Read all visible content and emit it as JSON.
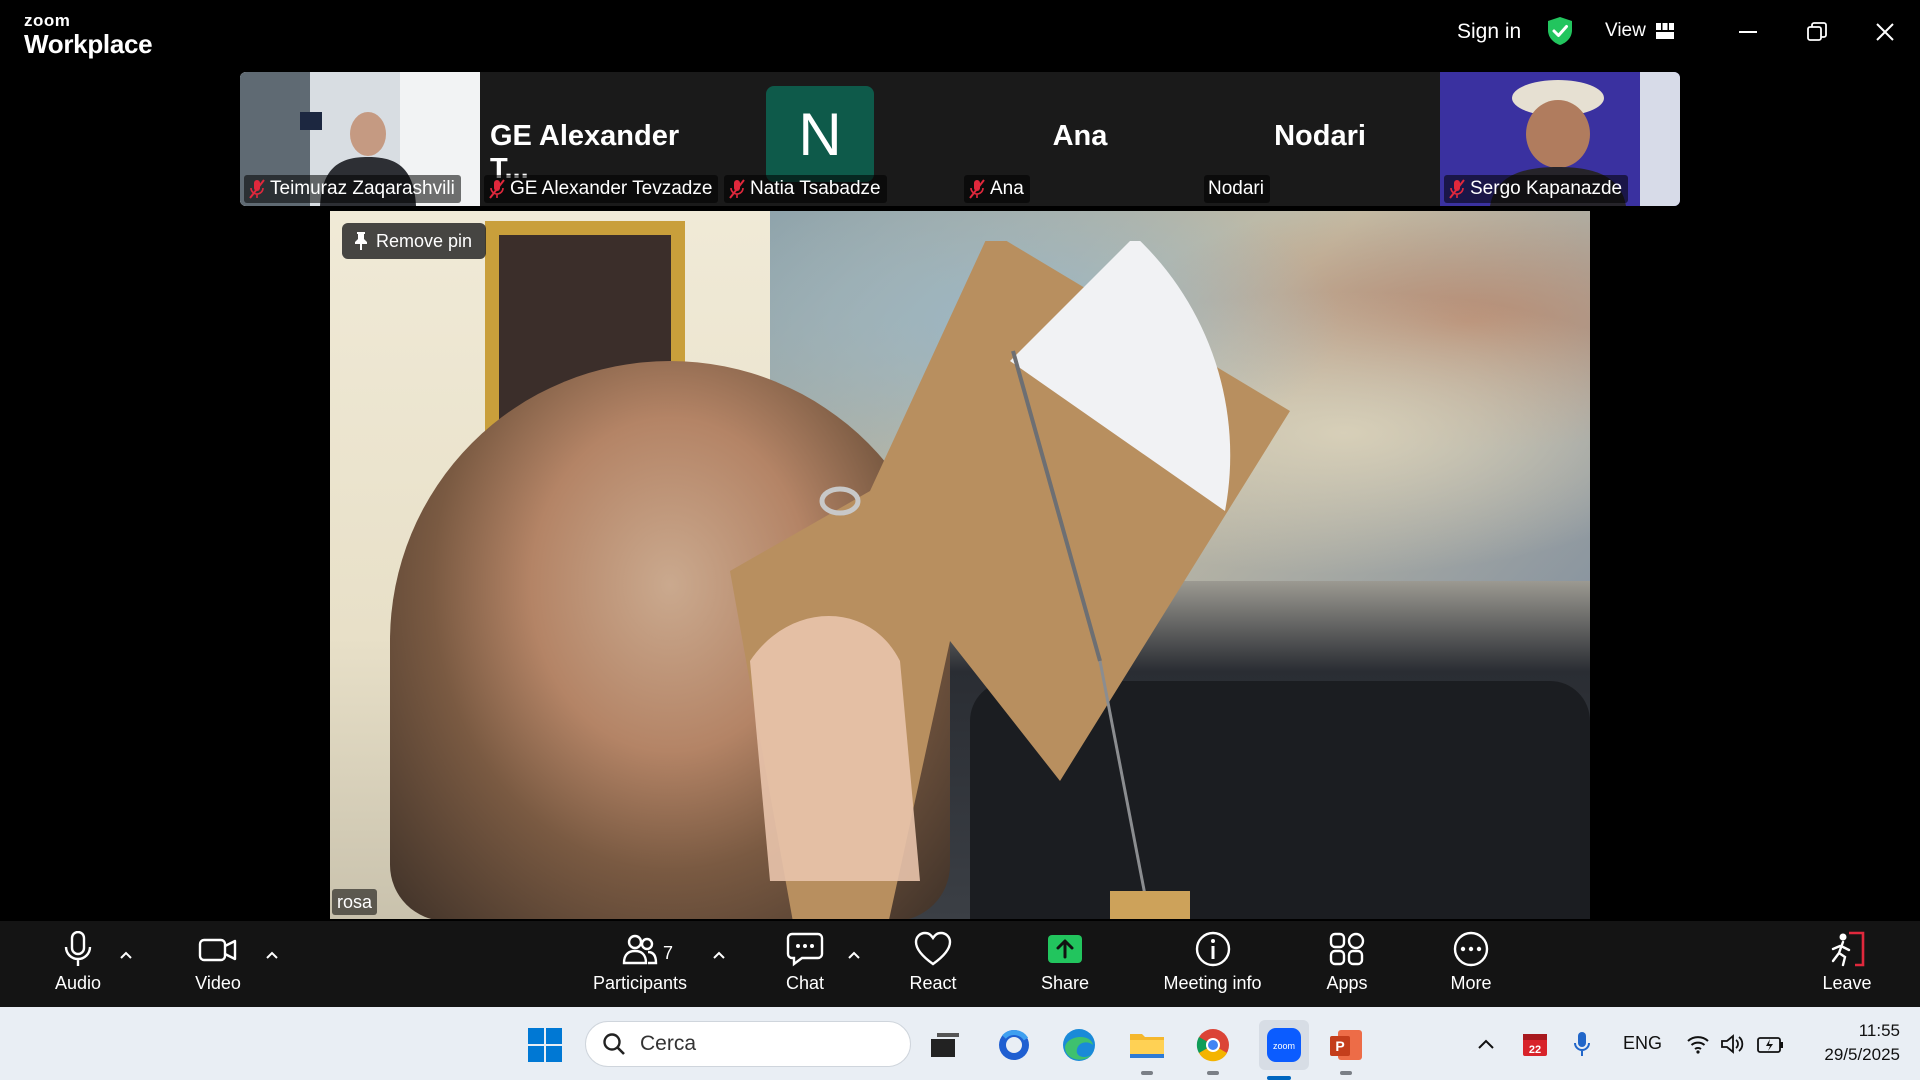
{
  "app": {
    "brand_small": "zoom",
    "brand_big": "Workplace",
    "sign_in": "Sign in",
    "view": "View"
  },
  "participants_strip": [
    {
      "name": "Teimuraz Zaqarashvili",
      "muted": true,
      "type": "video"
    },
    {
      "display": "GE Alexander T...",
      "name": "GE Alexander Tevzadze",
      "muted": true,
      "type": "name"
    },
    {
      "avatar_letter": "N",
      "name": "Natia Tsabadze",
      "muted": true,
      "type": "avatar"
    },
    {
      "display": "Ana",
      "name": "Ana",
      "muted": true,
      "type": "name"
    },
    {
      "display": "Nodari",
      "name": "Nodari",
      "muted": false,
      "type": "name"
    },
    {
      "name": "Sergo Kapanazde",
      "muted": true,
      "type": "video"
    }
  ],
  "main_video": {
    "remove_pin": "Remove pin",
    "speaker_name": "rosa"
  },
  "toolbar": {
    "audio": "Audio",
    "video": "Video",
    "participants": "Participants",
    "participants_count": "7",
    "chat": "Chat",
    "react": "React",
    "share": "Share",
    "meeting_info": "Meeting info",
    "apps": "Apps",
    "more": "More",
    "leave": "Leave"
  },
  "taskbar": {
    "search_placeholder": "Cerca",
    "language": "ENG",
    "time": "11:55",
    "date": "29/5/2025",
    "calendar_badge": "22"
  },
  "colors": {
    "share_green": "#22c55e",
    "leave_red": "#e0283c",
    "shield_green": "#22c55e",
    "avatar_teal": "#0e5a4a"
  }
}
